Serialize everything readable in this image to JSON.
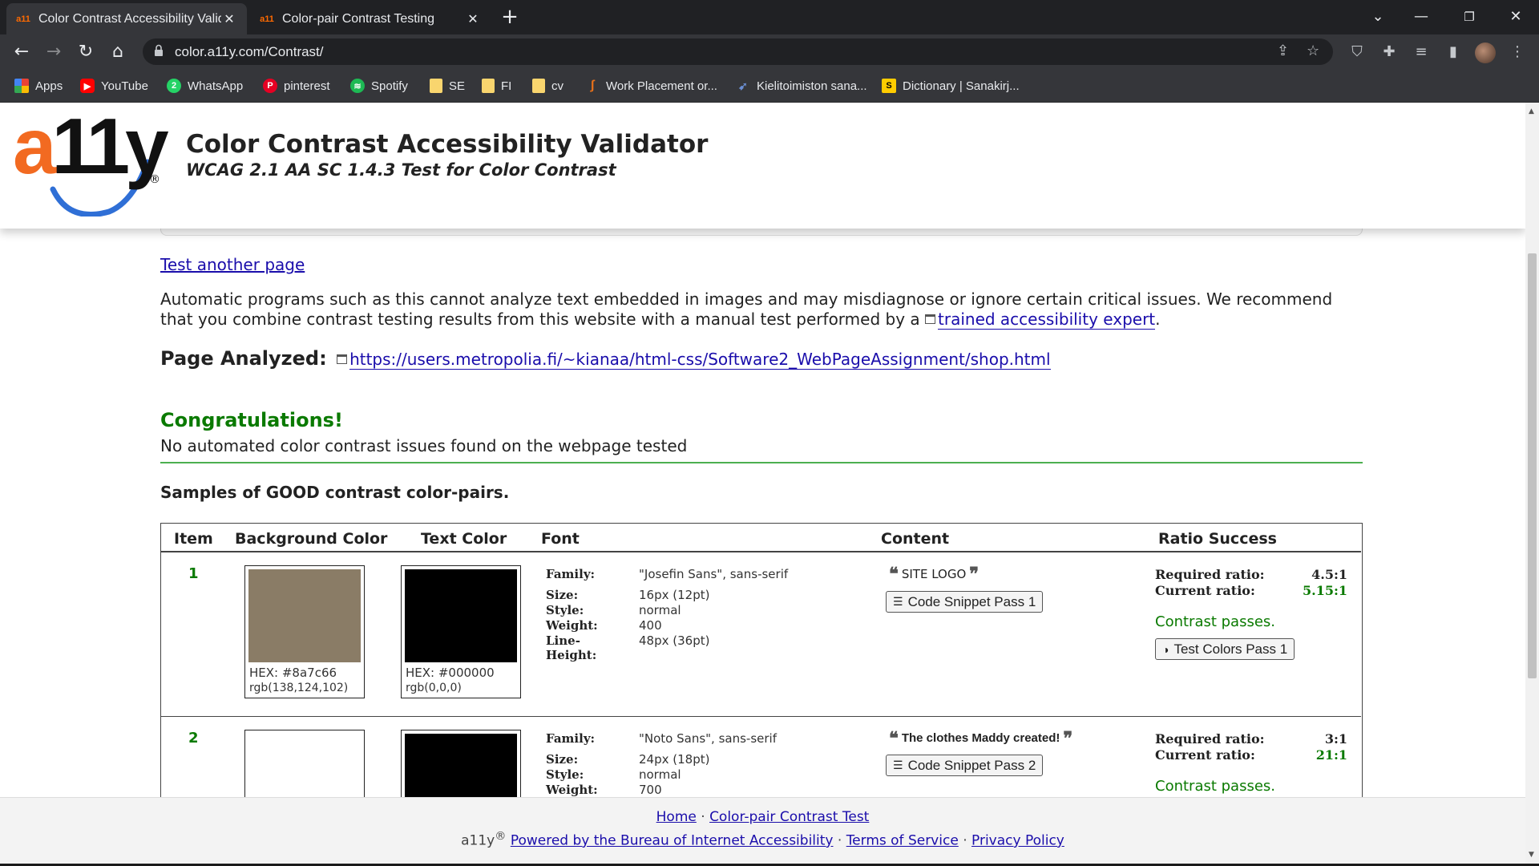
{
  "browser": {
    "tabs": [
      {
        "title": "Color Contrast Accessibility Valid",
        "active": true
      },
      {
        "title": "Color-pair Contrast Testing",
        "active": false
      }
    ],
    "url": "color.a11y.com/Contrast/",
    "bookmarks": [
      {
        "label": "Apps",
        "icon": "apps-grid-icon",
        "color": "#ea4335"
      },
      {
        "label": "YouTube",
        "icon": "youtube-icon",
        "color": "#ff0000"
      },
      {
        "label": "WhatsApp",
        "icon": "whatsapp-icon",
        "color": "#25d366"
      },
      {
        "label": "pinterest",
        "icon": "pinterest-icon",
        "color": "#e60023"
      },
      {
        "label": "Spotify",
        "icon": "spotify-icon",
        "color": "#1db954"
      },
      {
        "label": "SE",
        "icon": "folder-icon",
        "color": "#f9d56e"
      },
      {
        "label": "FI",
        "icon": "folder-icon",
        "color": "#f9d56e"
      },
      {
        "label": "cv",
        "icon": "folder-icon",
        "color": "#f9d56e"
      },
      {
        "label": "Work Placement or...",
        "icon": "work-placement-icon",
        "color": "#e8711a"
      },
      {
        "label": "Kielitoimiston sana...",
        "icon": "kielitoimisto-icon",
        "color": "#6b8fd4"
      },
      {
        "label": "Dictionary | Sanakirj...",
        "icon": "dictionary-icon",
        "color": "#ffcc00"
      }
    ]
  },
  "site": {
    "logo_text": "a11y",
    "logo_reg": "®",
    "title": "Color Contrast Accessibility Validator",
    "subtitle": "WCAG 2.1 AA SC 1.4.3 Test for Color Contrast"
  },
  "main": {
    "test_another": "Test another page",
    "disclaimer_text": "Automatic programs such as this cannot analyze text embedded in images and may misdiagnose or ignore certain critical issues. We recommend that you combine contrast testing results from this website with a manual test performed by a ",
    "disclaimer_link": "trained accessibility expert",
    "disclaimer_end": ".",
    "page_analyzed_label": "Page Analyzed:",
    "page_analyzed_url": "https://users.metropolia.fi/~kianaa/html-css/Software2_WebPageAssignment/shop.html",
    "congrats": "Congratulations!",
    "no_issues": "No automated color contrast issues found on the webpage tested",
    "samples_heading": "Samples of GOOD contrast color-pairs."
  },
  "table": {
    "headers": [
      "Item",
      "Background Color",
      "Text Color",
      "Font",
      "Content",
      "Ratio Success"
    ],
    "font_keys": [
      "Family:",
      "Size:",
      "Style:",
      "Weight:",
      "Line-Height:"
    ],
    "ratio_keys": [
      "Required ratio:",
      "Current ratio:"
    ],
    "rows": [
      {
        "item": "1",
        "bg": {
          "color": "#8a7c66",
          "hex": "HEX: #8a7c66",
          "rgb": "rgb(138,124,102)"
        },
        "fg": {
          "color": "#000000",
          "hex": "HEX: #000000",
          "rgb": "rgb(0,0,0)"
        },
        "family": "\"Josefin Sans\", sans-serif",
        "size": "16px (12pt)",
        "style": "normal",
        "weight": "400",
        "line_height": "48px (36pt)",
        "content": "SITE LOGO",
        "snippet_button": "Code Snippet Pass 1",
        "required_ratio": "4.5:1",
        "current_ratio": "5.15:1",
        "result": "Contrast passes.",
        "test_button": "Test Colors Pass 1"
      },
      {
        "item": "2",
        "bg": {
          "color": "#ffffff",
          "hex": "",
          "rgb": ""
        },
        "fg": {
          "color": "#000000",
          "hex": "",
          "rgb": ""
        },
        "family": "\"Noto Sans\", sans-serif",
        "size": "24px (18pt)",
        "style": "normal",
        "weight": "700",
        "line_height": "",
        "content": "The clothes Maddy created!",
        "snippet_button": "Code Snippet Pass 2",
        "required_ratio": "3:1",
        "current_ratio": "21:1",
        "result": "Contrast passes.",
        "test_button": ""
      }
    ]
  },
  "footer": {
    "home": "Home",
    "sep": "·",
    "color_pair": "Color-pair Contrast Test",
    "brand": "a11y",
    "reg": "®",
    "powered": "Powered by the Bureau of Internet Accessibility",
    "terms": "Terms of Service",
    "privacy": "Privacy Policy"
  }
}
